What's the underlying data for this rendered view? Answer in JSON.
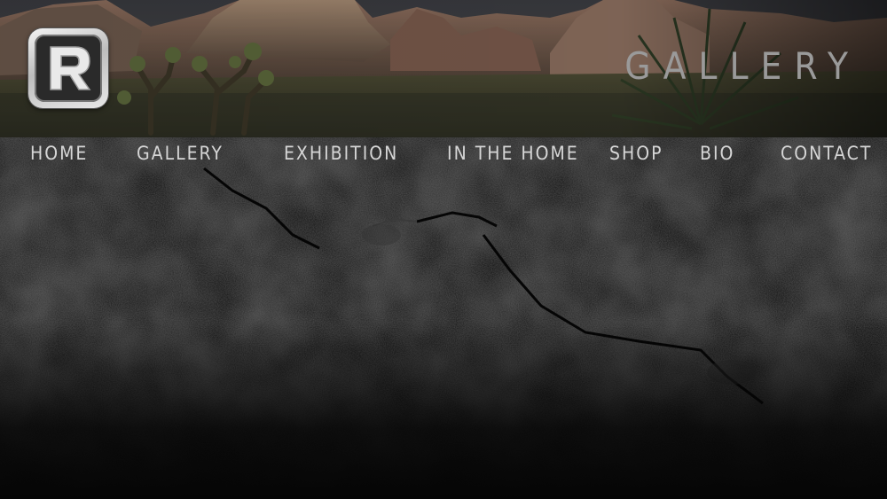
{
  "header": {
    "section_title": "GALLERY",
    "logo_icon": "r-logo-icon"
  },
  "nav": {
    "items": [
      {
        "label": "HOME"
      },
      {
        "label": "GALLERY"
      },
      {
        "label": "EXHIBITION"
      },
      {
        "label": "IN THE HOME"
      },
      {
        "label": "SHOP"
      },
      {
        "label": "BIO"
      },
      {
        "label": "CONTACT"
      }
    ]
  },
  "colors": {
    "nav_text": "#d6d6d6",
    "title_text": "#9a9a9a",
    "background": "#0c0c0c"
  }
}
